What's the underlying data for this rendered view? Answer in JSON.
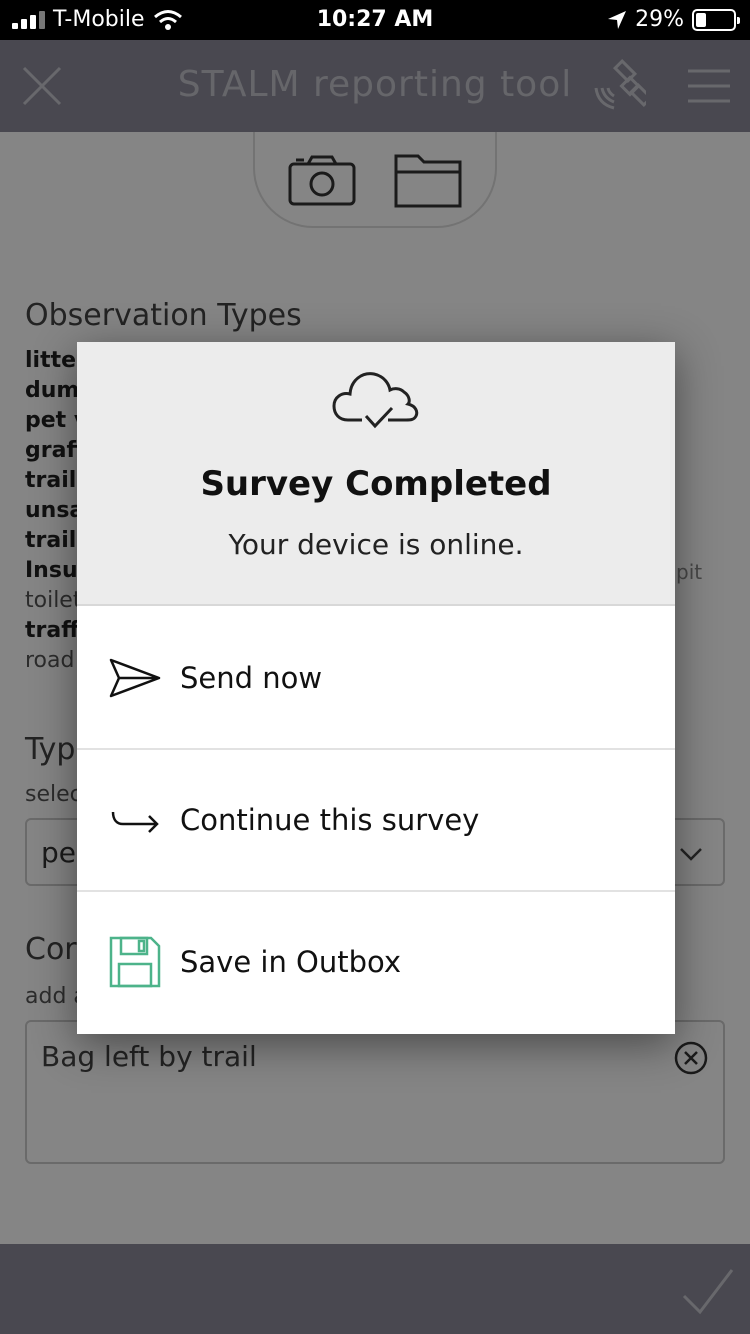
{
  "status_bar": {
    "carrier": "T-Mobile",
    "time": "10:27 AM",
    "battery": "29%",
    "battery_level": 0.29
  },
  "header": {
    "title": "STALM reporting tool"
  },
  "form": {
    "observation_title": "Observation Types",
    "observation_items": [
      {
        "text": "litter",
        "bold": true
      },
      {
        "text": "dum",
        "bold": true
      },
      {
        "text": "pet v",
        "bold": true
      },
      {
        "text": "graff",
        "bold": true
      },
      {
        "text": "trail c",
        "bold": true
      },
      {
        "text": "unsa",
        "bold": true
      },
      {
        "text": "trail s",
        "bold": true
      },
      {
        "text": "Insuf",
        "bold": true
      },
      {
        "text": "toilet",
        "bold": false
      },
      {
        "text": "traffi",
        "bold": true
      },
      {
        "text": "road",
        "bold": false
      }
    ],
    "pit_fragment": "pit",
    "type_title": "Typ",
    "type_hint": "selec",
    "type_value": "pe",
    "comment_title": "Cor",
    "comment_hint": "add a",
    "comment_value": "Bag left by trail"
  },
  "modal": {
    "title": "Survey Completed",
    "subtitle": "Your device is online.",
    "options": [
      {
        "label": "Send now",
        "icon": "send-icon"
      },
      {
        "label": "Continue this survey",
        "icon": "continue-arrow-icon"
      },
      {
        "label": "Save in Outbox",
        "icon": "save-icon"
      }
    ]
  },
  "colors": {
    "header_bg": "#8c8b99",
    "save_icon": "#4db38a"
  }
}
